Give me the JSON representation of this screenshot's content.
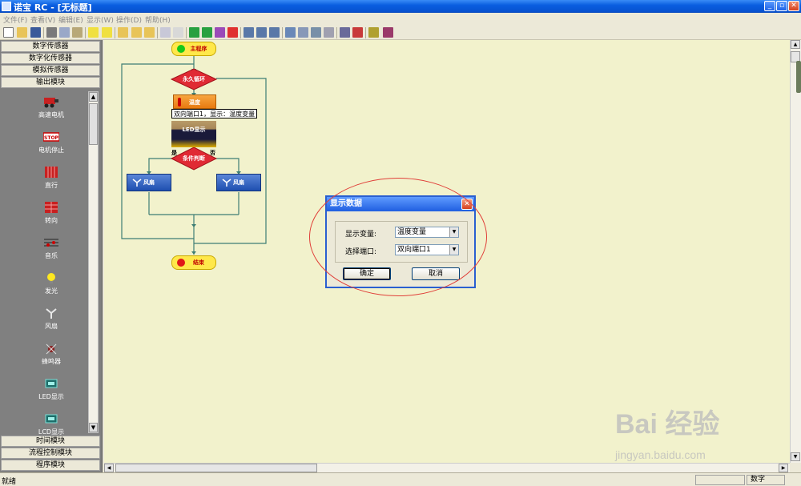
{
  "window": {
    "title": "诺宝 RC - [无标题]",
    "min_label": "_",
    "restore_label": "▫",
    "close_label": "✕"
  },
  "menu": [
    "文件(F)",
    "查看(V)",
    "编辑(E)",
    "显示(W)",
    "操作(D)",
    "帮助(H)"
  ],
  "sidebar": {
    "top_categories": [
      "数字传感器",
      "数字化传感器",
      "模拟传感器",
      "输出模块"
    ],
    "items": [
      {
        "label": "高速电机",
        "icon": "motor-icon"
      },
      {
        "label": "电机停止",
        "icon": "stop-sign-icon"
      },
      {
        "label": "直行",
        "icon": "grid-forward-icon"
      },
      {
        "label": "转向",
        "icon": "grid-turn-icon"
      },
      {
        "label": "音乐",
        "icon": "music-icon"
      },
      {
        "label": "发光",
        "icon": "bulb-icon"
      },
      {
        "label": "风扇",
        "icon": "fan-icon"
      },
      {
        "label": "蜂鸣器",
        "icon": "buzzer-icon"
      },
      {
        "label": "LED显示",
        "icon": "led-icon"
      },
      {
        "label": "LCD显示",
        "icon": "lcd-icon"
      }
    ],
    "bottom_categories": [
      "时间模块",
      "流程控制模块",
      "程序模块"
    ]
  },
  "flowchart": {
    "start": "主程序",
    "loop": "永久循环",
    "temp": "温度",
    "tooltip": "双向端口1，显示：温度变量",
    "led": "LED显示",
    "cond": "条件判断",
    "yes": "是",
    "no": "否",
    "fan_left": "风扇",
    "fan_right": "风扇",
    "end": "结束"
  },
  "dialog": {
    "title": "显示数据",
    "var_label": "显示变量:",
    "var_value": "温度变量",
    "port_label": "选择端口:",
    "port_value": "双向端口1",
    "ok": "确定",
    "cancel": "取消"
  },
  "status": {
    "left": "就绪",
    "mode": "数字"
  },
  "watermark": {
    "brand": "Bai 经验",
    "url": "jingyan.baidu.com"
  }
}
